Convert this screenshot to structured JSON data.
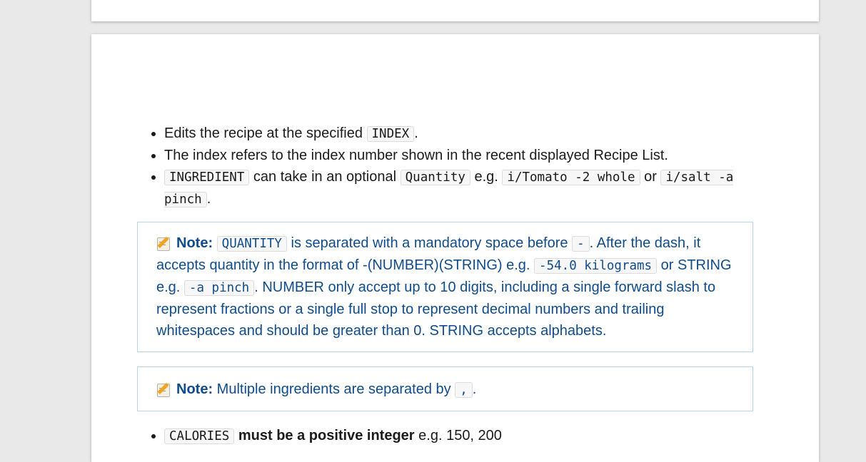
{
  "bullets": [
    {
      "pre": "Edits the recipe at the specified ",
      "code": "INDEX",
      "post": "."
    },
    {
      "text": "The index refers to the index number shown in the recent displayed Recipe List."
    },
    {
      "code1": "INGREDIENT",
      "mid1": " can take in an optional ",
      "code2": "Quantity",
      "mid2": " e.g. ",
      "code3": "i/Tomato -2 whole",
      "mid3": " or ",
      "code4": "i/salt -a pinch",
      "post": "."
    }
  ],
  "note1": {
    "label": "Note:",
    "code1": "QUANTITY",
    "text1": " is separated with a mandatory space before ",
    "code2": "-",
    "text2": ". After the dash, it accepts quantity in the format of -(NUMBER)(STRING) e.g. ",
    "code3": "-54.0 kilograms",
    "text3": " or STRING e.g. ",
    "code4": "-a pinch",
    "text4": ". NUMBER only accept up to 10 digits, including a single forward slash to represent fractions or a single full stop to represent decimal numbers and trailing whitespaces and should be greater than 0. STRING accepts alphabets."
  },
  "note2": {
    "label": "Note:",
    "text": " Multiple ingredients are separated by ",
    "code": ",",
    "post": "."
  },
  "bottom_bullet": {
    "code": "CALORIES",
    "bold": " must be a positive integer",
    "text": " e.g. 150, 200"
  },
  "icons": {
    "note": "memo-icon"
  }
}
